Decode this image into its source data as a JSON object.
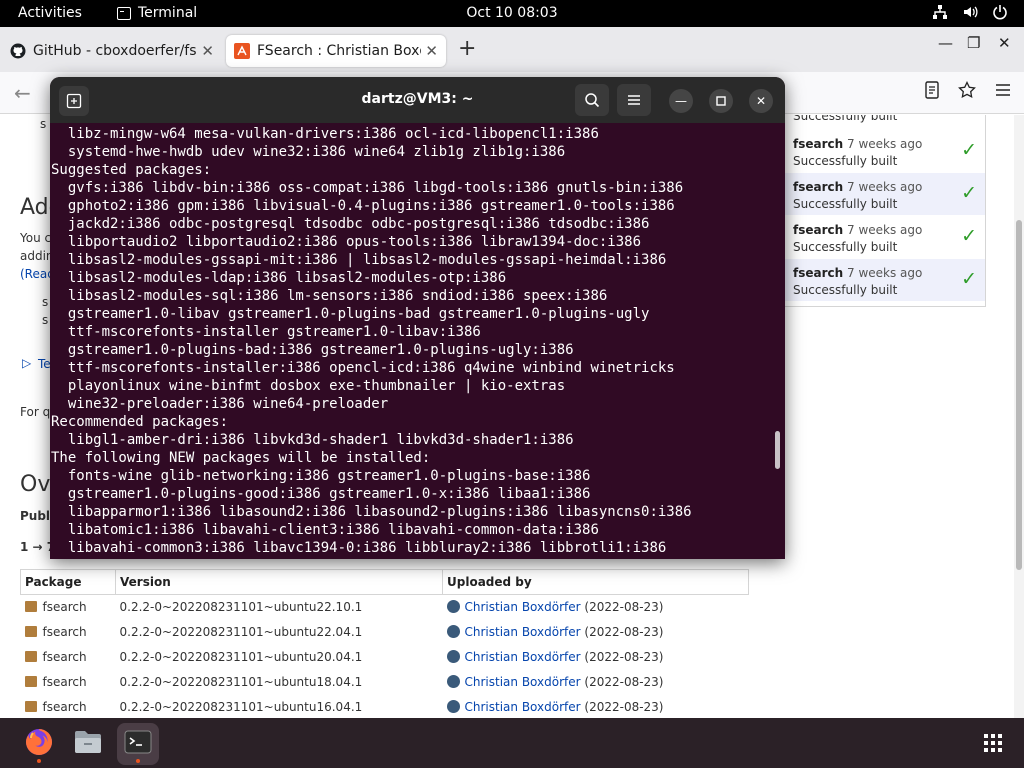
{
  "topbar": {
    "activities": "Activities",
    "app_name": "Terminal",
    "clock": "Oct 10  08:03",
    "tray_icons": [
      "network-icon",
      "volume-icon",
      "power-icon"
    ]
  },
  "browser": {
    "tabs": [
      {
        "title": "GitHub - cboxdoerfer/fse",
        "icon": "github-icon"
      },
      {
        "title": "FSearch : Christian Boxdö",
        "icon": "launchpad-icon"
      }
    ],
    "window_controls": {
      "minimize": "—",
      "maximize": "❐",
      "close": "✕"
    }
  },
  "page": {
    "heading_add": "Add",
    "frag_you": "You c",
    "frag_addin": "addin",
    "frag_read": "(Read",
    "frag_s": "s",
    "frag_te": "Te",
    "frag_forq": "For q",
    "heading_ov": "Ov",
    "frag_publi": "Publi",
    "frag_range": "1 → 7",
    "builds": [
      {
        "name": "fsearch",
        "time": "7 weeks ago",
        "status": "Successfully built"
      },
      {
        "name": "fsearch",
        "time": "7 weeks ago",
        "status": "Successfully built"
      },
      {
        "name": "fsearch",
        "time": "7 weeks ago",
        "status": "Successfully built"
      },
      {
        "name": "fsearch",
        "time": "7 weeks ago",
        "status": "Successfully built"
      }
    ],
    "top_build_status": "Successfully built",
    "table": {
      "headers": [
        "Package",
        "Version",
        "Uploaded by"
      ],
      "rows": [
        {
          "package": "fsearch",
          "version": "0.2.2-0~202208231101~ubuntu22.10.1",
          "uploader": "Christian Boxdörfer",
          "date": "(2022-08-23)"
        },
        {
          "package": "fsearch",
          "version": "0.2.2-0~202208231101~ubuntu22.04.1",
          "uploader": "Christian Boxdörfer",
          "date": "(2022-08-23)"
        },
        {
          "package": "fsearch",
          "version": "0.2.2-0~202208231101~ubuntu20.04.1",
          "uploader": "Christian Boxdörfer",
          "date": "(2022-08-23)"
        },
        {
          "package": "fsearch",
          "version": "0.2.2-0~202208231101~ubuntu18.04.1",
          "uploader": "Christian Boxdörfer",
          "date": "(2022-08-23)"
        },
        {
          "package": "fsearch",
          "version": "0.2.2-0~202208231101~ubuntu16.04.1",
          "uploader": "Christian Boxdörfer",
          "date": "(2022-08-23)"
        }
      ]
    }
  },
  "terminal": {
    "title": "dartz@VM3: ~",
    "lines": [
      "  libz-mingw-w64 mesa-vulkan-drivers:i386 ocl-icd-libopencl1:i386",
      "  systemd-hwe-hwdb udev wine32:i386 wine64 zlib1g zlib1g:i386",
      "Suggested packages:",
      "  gvfs:i386 libdv-bin:i386 oss-compat:i386 libgd-tools:i386 gnutls-bin:i386",
      "  gphoto2:i386 gpm:i386 libvisual-0.4-plugins:i386 gstreamer1.0-tools:i386",
      "  jackd2:i386 odbc-postgresql tdsodbc odbc-postgresql:i386 tdsodbc:i386",
      "  libportaudio2 libportaudio2:i386 opus-tools:i386 libraw1394-doc:i386",
      "  libsasl2-modules-gssapi-mit:i386 | libsasl2-modules-gssapi-heimdal:i386",
      "  libsasl2-modules-ldap:i386 libsasl2-modules-otp:i386",
      "  libsasl2-modules-sql:i386 lm-sensors:i386 sndiod:i386 speex:i386",
      "  gstreamer1.0-libav gstreamer1.0-plugins-bad gstreamer1.0-plugins-ugly",
      "  ttf-mscorefonts-installer gstreamer1.0-libav:i386",
      "  gstreamer1.0-plugins-bad:i386 gstreamer1.0-plugins-ugly:i386",
      "  ttf-mscorefonts-installer:i386 opencl-icd:i386 q4wine winbind winetricks",
      "  playonlinux wine-binfmt dosbox exe-thumbnailer | kio-extras",
      "  wine32-preloader:i386 wine64-preloader",
      "Recommended packages:",
      "  libgl1-amber-dri:i386 libvkd3d-shader1 libvkd3d-shader1:i386",
      "The following NEW packages will be installed:",
      "  fonts-wine glib-networking:i386 gstreamer1.0-plugins-base:i386",
      "  gstreamer1.0-plugins-good:i386 gstreamer1.0-x:i386 libaa1:i386",
      "  libapparmor1:i386 libasound2:i386 libasound2-plugins:i386 libasyncns0:i386",
      "  libatomic1:i386 libavahi-client3:i386 libavahi-common-data:i386",
      "  libavahi-common3:i386 libavc1394-0:i386 libbluray2:i386 libbrotli1:i386"
    ]
  },
  "dock": {
    "items": [
      "firefox-icon",
      "files-icon",
      "terminal-icon"
    ],
    "colors": {
      "terminal_bg": "#300a24",
      "ubuntu_orange": "#e95420",
      "check_green": "#2f9d2a"
    }
  }
}
